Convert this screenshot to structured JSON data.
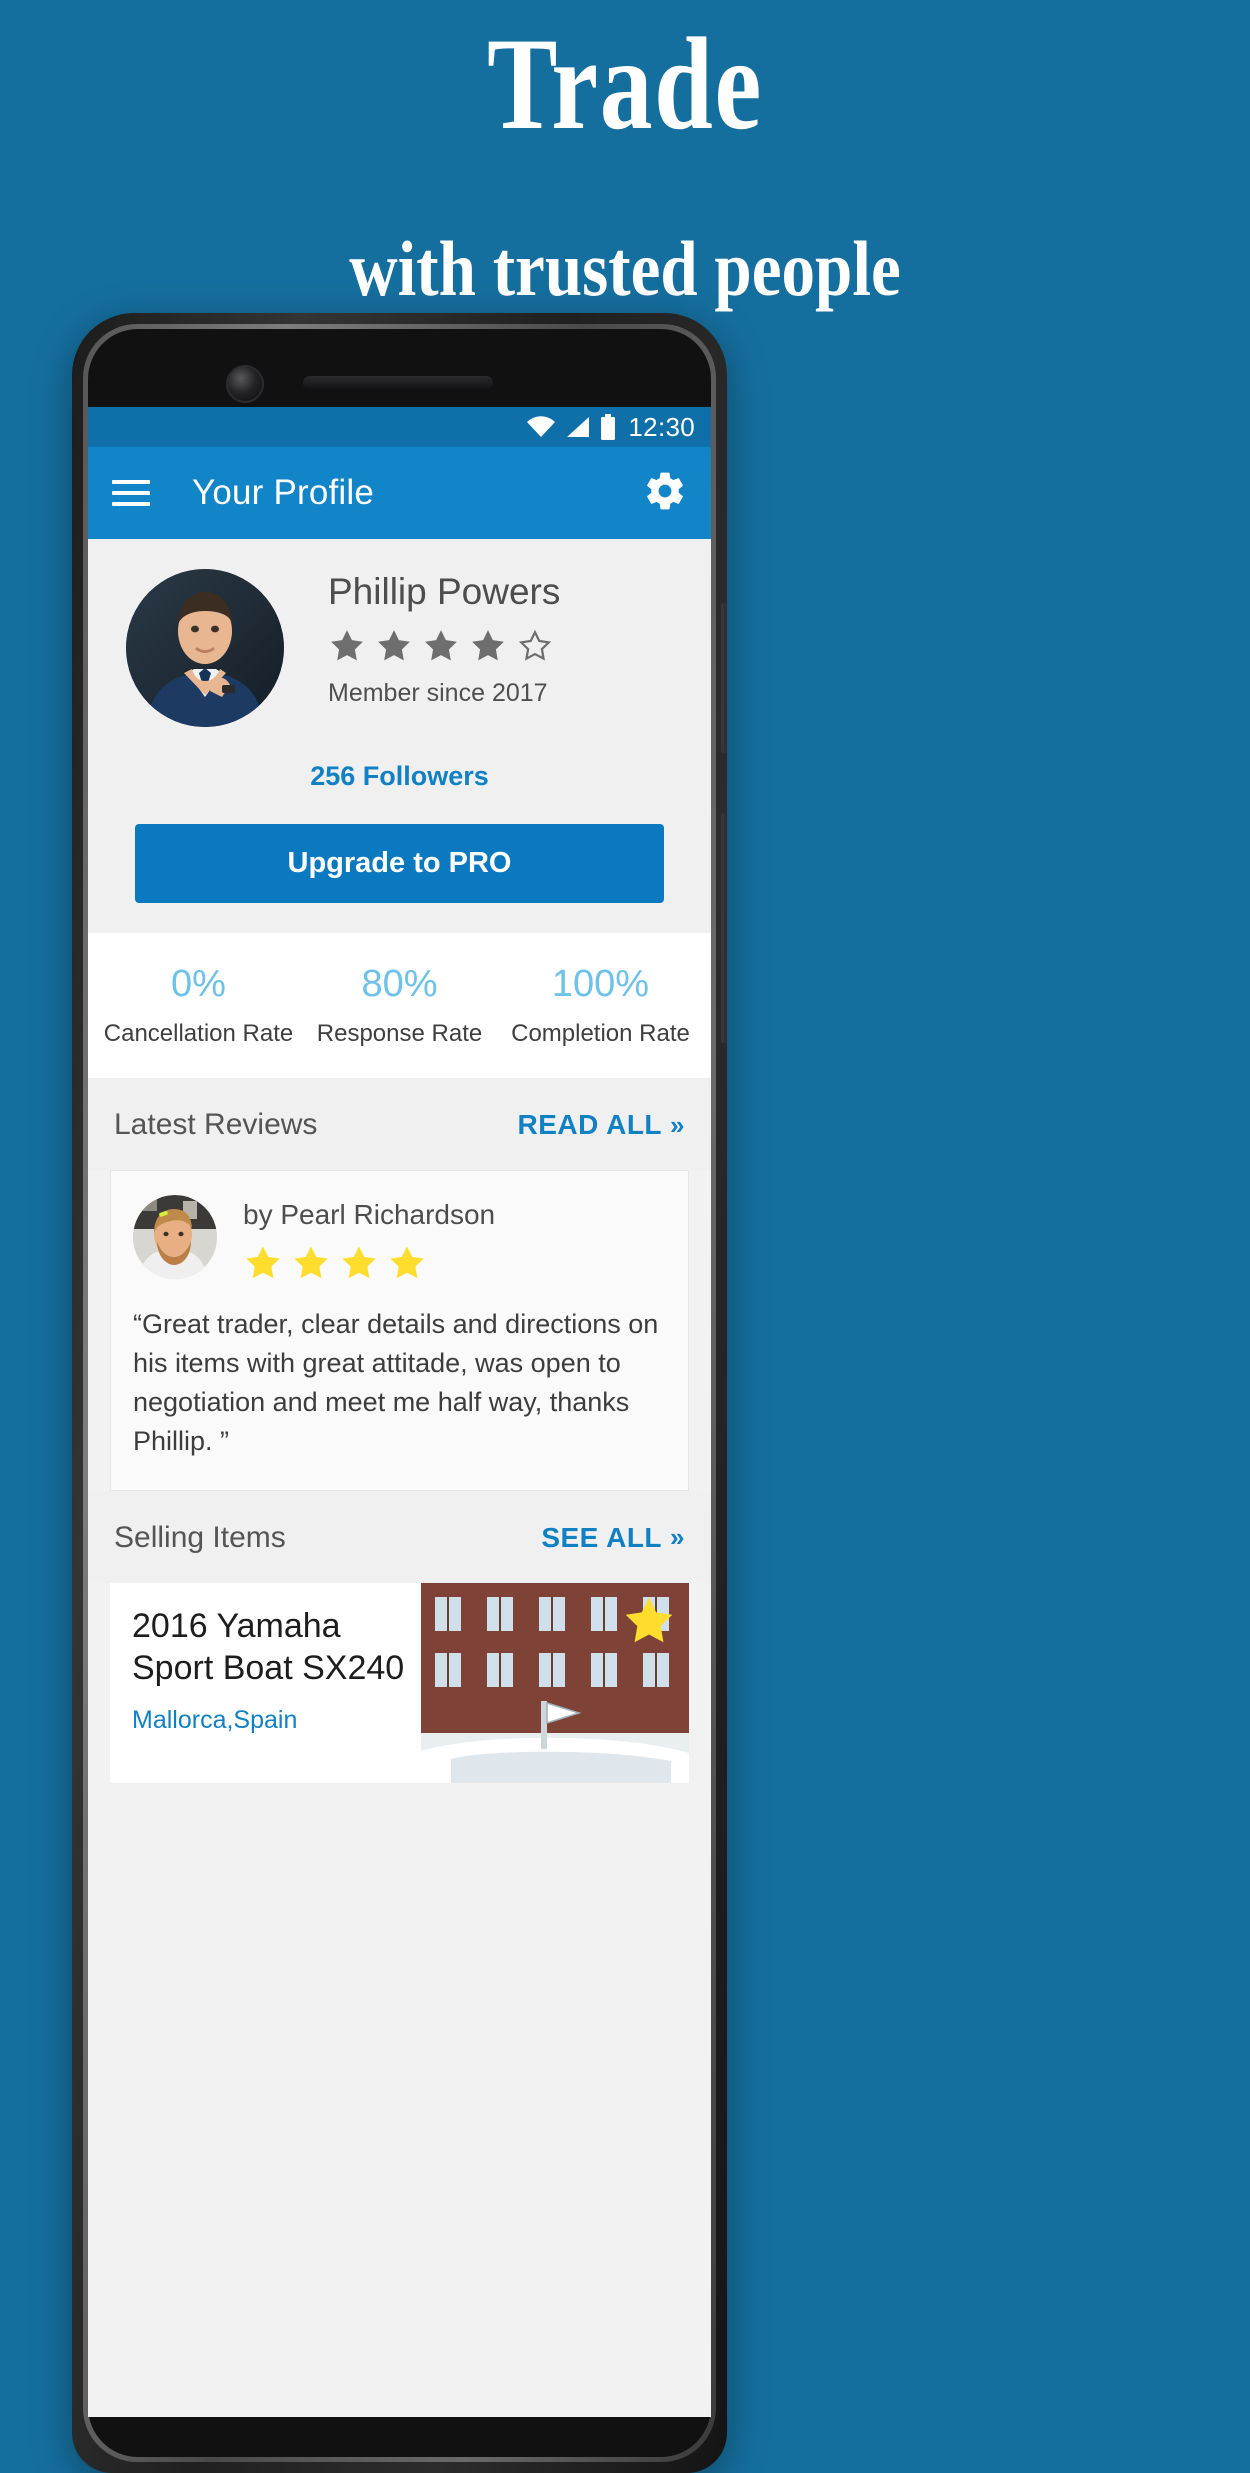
{
  "hero": {
    "title": "Trade",
    "subtitle": "with trusted people",
    "bg_color": "#156f9e",
    "text_color": "#ffffff"
  },
  "phone": {
    "statusbar": {
      "time": "12:30",
      "icons": [
        "wifi-icon",
        "signal-icon",
        "battery-icon"
      ],
      "bg_color": "#0f6fa8"
    },
    "appbar": {
      "menu_icon": "hamburger-icon",
      "title": "Your Profile",
      "settings_icon": "gear-icon",
      "bg_color": "#1284c8"
    },
    "profile": {
      "avatar": "user-photo",
      "name": "Phillip Powers",
      "rating_filled": 4,
      "rating_total": 5,
      "member_since": "Member since 2017",
      "followers": "256 Followers",
      "upgrade_label": "Upgrade to PRO",
      "upgrade_color": "#0b79bf"
    },
    "stats": [
      {
        "value": "0%",
        "label": "Cancellation Rate"
      },
      {
        "value": "80%",
        "label": "Response Rate"
      },
      {
        "value": "100%",
        "label": "Completion Rate"
      }
    ],
    "stats_value_color": "#6ec1e8",
    "reviews_section": {
      "title": "Latest Reviews",
      "link": "READ ALL",
      "link_chevron": "»"
    },
    "review": {
      "avatar": "reviewer-photo",
      "author": "by Pearl Richardson",
      "stars": 4,
      "star_color": "#ffdd2e",
      "text": "“Great trader, clear details and directions on his items with great attitade, was open to negotiation and meet me half way, thanks Phillip. ”"
    },
    "selling_section": {
      "title": "Selling Items",
      "link": "SEE ALL",
      "link_chevron": "»"
    },
    "selling_item": {
      "title": "2016 Yamaha Sport Boat SX240",
      "location": "Mallorca,Spain",
      "badge_icon": "star-badge-icon",
      "image": "boat-photo"
    }
  }
}
